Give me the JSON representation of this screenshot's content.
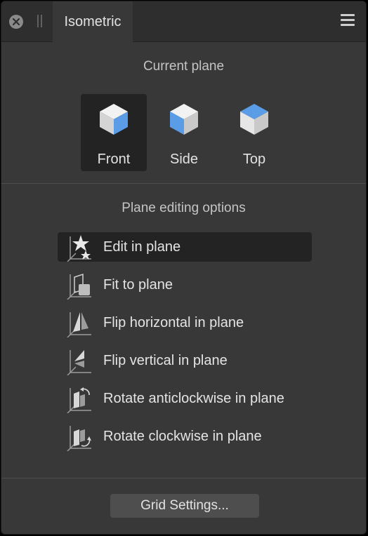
{
  "window": {
    "tab_title": "Isometric"
  },
  "current_plane": {
    "heading": "Current plane",
    "selected": "Front",
    "options": [
      {
        "label": "Front",
        "icon": "cube-front-icon"
      },
      {
        "label": "Side",
        "icon": "cube-side-icon"
      },
      {
        "label": "Top",
        "icon": "cube-top-icon"
      }
    ]
  },
  "editing": {
    "heading": "Plane editing options",
    "selected": "Edit in plane",
    "items": [
      {
        "label": "Edit in plane",
        "icon": "edit-in-plane-icon"
      },
      {
        "label": "Fit to plane",
        "icon": "fit-to-plane-icon"
      },
      {
        "label": "Flip horizontal in plane",
        "icon": "flip-horizontal-icon"
      },
      {
        "label": "Flip vertical in plane",
        "icon": "flip-vertical-icon"
      },
      {
        "label": "Rotate anticlockwise in plane",
        "icon": "rotate-anticlockwise-icon"
      },
      {
        "label": "Rotate clockwise in plane",
        "icon": "rotate-clockwise-icon"
      }
    ]
  },
  "footer": {
    "grid_settings_label": "Grid Settings..."
  },
  "colors": {
    "panel_bg": "#383838",
    "selected_bg": "#232323",
    "accent_blue": "#5a9de6",
    "cube_face": "#d9d9d9"
  }
}
